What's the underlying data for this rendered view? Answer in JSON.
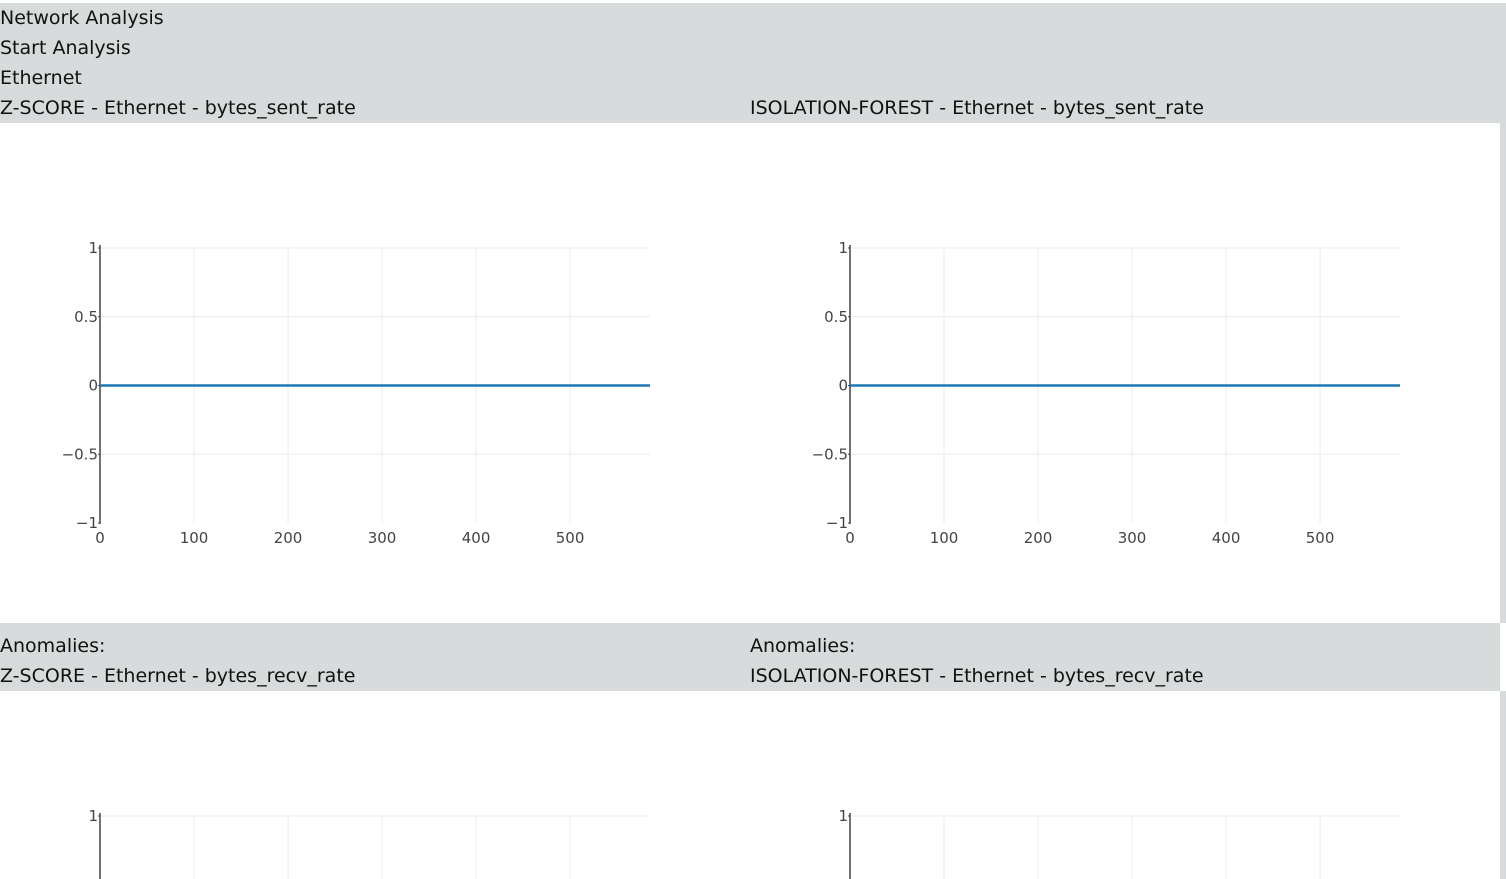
{
  "app": {
    "title": "Network Analysis",
    "start_button_label": "Start Analysis",
    "interface_label": "Ethernet"
  },
  "sections": [
    {
      "left_title": "Z-SCORE - Ethernet - bytes_sent_rate",
      "right_title": "ISOLATION-FOREST - Ethernet - bytes_sent_rate",
      "left_anomalies_label": "Anomalies:",
      "right_anomalies_label": "Anomalies:"
    },
    {
      "left_title": "Z-SCORE - Ethernet - bytes_recv_rate",
      "right_title": "ISOLATION-FOREST - Ethernet - bytes_recv_rate"
    }
  ],
  "chart_data": [
    {
      "type": "line",
      "title": "",
      "xlabel": "",
      "ylabel": "",
      "x": [
        0,
        585
      ],
      "series": [
        {
          "values": [
            0,
            0
          ]
        }
      ],
      "xlim": [
        0,
        585
      ],
      "ylim": [
        -1,
        1
      ],
      "xticks": [
        "0",
        "100",
        "200",
        "300",
        "400",
        "500"
      ],
      "yticks": [
        "1",
        "0.5",
        "0",
        "−0.5",
        "−1"
      ],
      "grid": true,
      "line_color": "#1f77b4"
    },
    {
      "type": "line",
      "title": "",
      "xlabel": "",
      "ylabel": "",
      "x": [
        0,
        585
      ],
      "series": [
        {
          "values": [
            0,
            0
          ]
        }
      ],
      "xlim": [
        0,
        585
      ],
      "ylim": [
        -1,
        1
      ],
      "xticks": [
        "0",
        "100",
        "200",
        "300",
        "400",
        "500"
      ],
      "yticks": [
        "1",
        "0.5",
        "0",
        "−0.5",
        "−1"
      ],
      "grid": true,
      "line_color": "#1f77b4"
    },
    {
      "type": "line",
      "title": "",
      "xlabel": "",
      "ylabel": "",
      "xlim": [
        0,
        585
      ],
      "ylim": [
        -1,
        1
      ],
      "xticks": [],
      "yticks": [
        "1"
      ],
      "grid": true
    },
    {
      "type": "line",
      "title": "",
      "xlabel": "",
      "ylabel": "",
      "xlim": [
        0,
        585
      ],
      "ylim": [
        -1,
        1
      ],
      "xticks": [],
      "yticks": [
        "1"
      ],
      "grid": true
    }
  ]
}
